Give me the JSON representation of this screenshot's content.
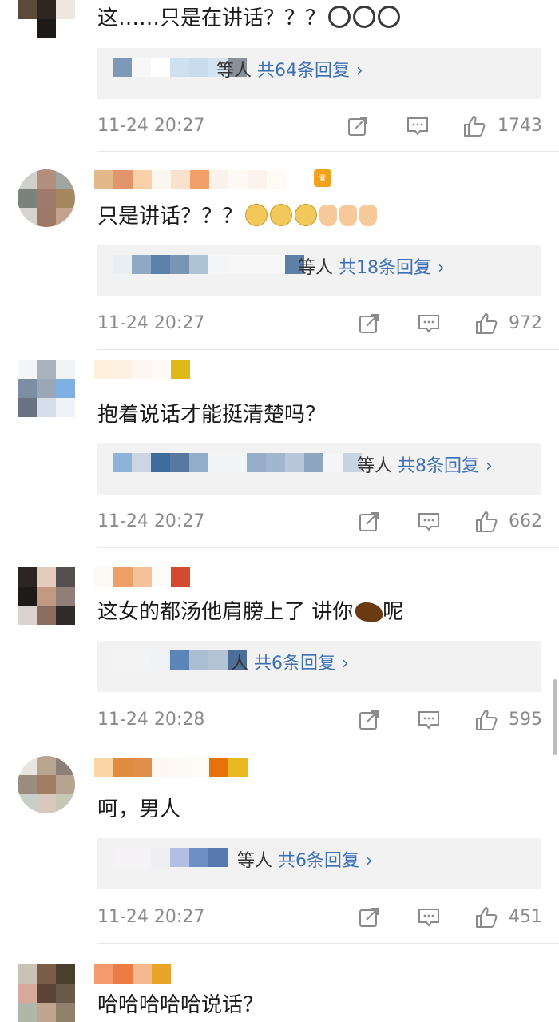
{
  "comments": [
    {
      "text": "这……只是在讲话？？？",
      "reply_suffix": "等人",
      "reply_count": "共64条回复",
      "time": "11-24 20:27",
      "likes": "1743"
    },
    {
      "text": "只是讲话？？？",
      "reply_suffix": "等人",
      "reply_count": "共18条回复",
      "time": "11-24 20:27",
      "likes": "972"
    },
    {
      "text": "抱着说话才能挺清楚吗？",
      "reply_suffix": "等人",
      "reply_count": "共8条回复",
      "time": "11-24 20:27",
      "likes": "662"
    },
    {
      "text": "这女的都汤他肩膀上了 讲你",
      "text_tail": "呢",
      "reply_suffix": "人",
      "reply_count": "共6条回复",
      "time": "11-24 20:28",
      "likes": "595"
    },
    {
      "text": "呵，男人",
      "reply_suffix": "等人",
      "reply_count": "共6条回复",
      "time": "11-24 20:27",
      "likes": "451"
    },
    {
      "text": "哈哈哈哈哈说话？"
    }
  ],
  "icons": {
    "share": "share-icon",
    "comment": "comment-icon",
    "like": "thumbs-up-icon",
    "chevron": "chevron-right-icon"
  },
  "colors": {
    "link": "#3c6fb4",
    "meta": "#8a8a8a",
    "reply_bg": "#f2f2f2"
  }
}
